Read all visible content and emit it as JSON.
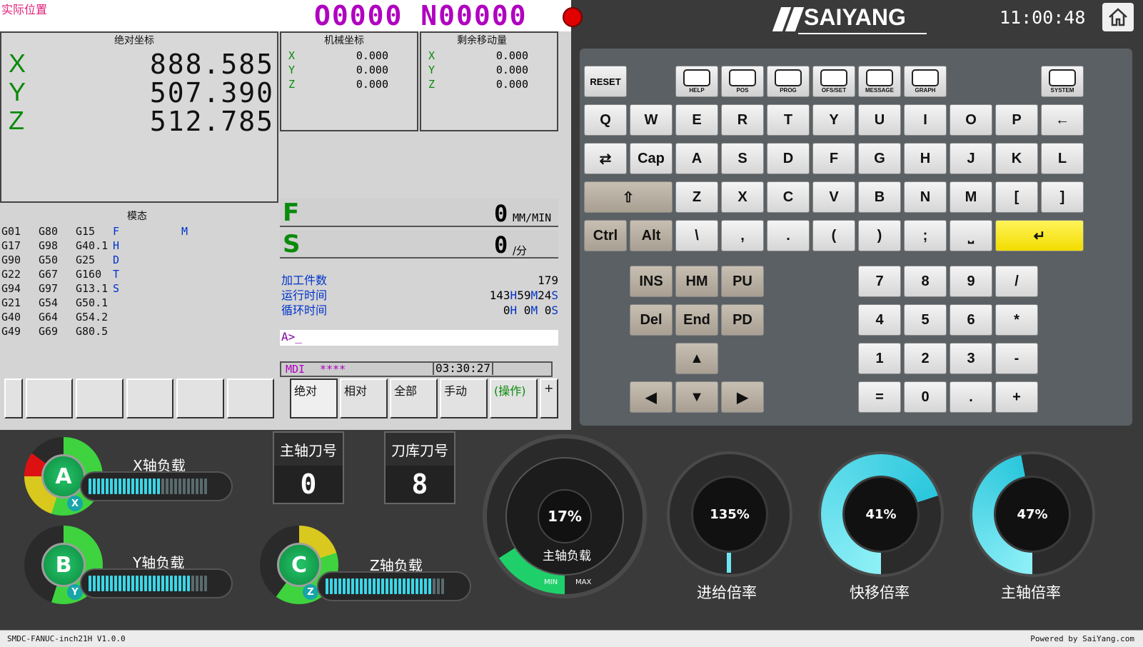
{
  "screen": {
    "title": "实际位置",
    "program": "O0000 N00000",
    "abs_title": "绝对坐标",
    "abs": [
      {
        "axis": "X",
        "value": "888.585"
      },
      {
        "axis": "Y",
        "value": "507.390"
      },
      {
        "axis": "Z",
        "value": "512.785"
      }
    ],
    "mach_title": "机械坐标",
    "mach": [
      {
        "axis": "X",
        "value": "0.000"
      },
      {
        "axis": "Y",
        "value": "0.000"
      },
      {
        "axis": "Z",
        "value": "0.000"
      }
    ],
    "remain_title": "剩余移动量",
    "remain": [
      {
        "axis": "X",
        "value": "0.000"
      },
      {
        "axis": "Y",
        "value": "0.000"
      },
      {
        "axis": "Z",
        "value": "0.000"
      }
    ],
    "modal_title": "模态",
    "modal_rows": [
      [
        "G01",
        "G80",
        "G15",
        "F",
        "M"
      ],
      [
        "G17",
        "G98",
        "G40.1",
        "H",
        ""
      ],
      [
        "G90",
        "G50",
        "G25",
        "D",
        ""
      ],
      [
        "G22",
        "G67",
        "G160",
        "T",
        ""
      ],
      [
        "G94",
        "G97",
        "G13.1",
        "S",
        ""
      ],
      [
        "G21",
        "G54",
        "G50.1",
        "",
        ""
      ],
      [
        "G40",
        "G64",
        "G54.2",
        "",
        ""
      ],
      [
        "G49",
        "G69",
        "G80.5",
        "",
        ""
      ]
    ],
    "feed_label": "F",
    "feed_value": "0",
    "feed_unit": "MM/MIN",
    "spindle_label": "S",
    "spindle_value": "0",
    "spindle_unit": "/分",
    "parts_label": "加工件数",
    "parts_value": "179",
    "run_label": "运行时间",
    "run_h": "143",
    "run_m": "59",
    "run_s": "24",
    "cycle_label": "循环时间",
    "cycle_h": "0",
    "cycle_m": "0",
    "cycle_s": "0",
    "h": "H",
    "m": "M",
    "s": "S",
    "prompt": "A>_",
    "mode": "MDI",
    "stars": "****",
    "clock": "03:30:27",
    "softkeys": [
      "绝对",
      "相对",
      "全部",
      "手动",
      "(操作)",
      "+"
    ]
  },
  "top": {
    "brand": "SAIYANG",
    "time": "11:00:48"
  },
  "func_keys": [
    "RESET",
    "HELP",
    "POS",
    "PROG",
    "OFS/SET",
    "MESSAGE",
    "GRAPH",
    "SYSTEM"
  ],
  "rows": {
    "r1": [
      "Q",
      "W",
      "E",
      "R",
      "T",
      "Y",
      "U",
      "I",
      "O",
      "P",
      "←"
    ],
    "r2": [
      "⇄",
      "Cap",
      "A",
      "S",
      "D",
      "F",
      "G",
      "H",
      "J",
      "K",
      "L"
    ],
    "r3": [
      "⇧",
      "Z",
      "X",
      "C",
      "V",
      "B",
      "N",
      "M",
      "[",
      "]"
    ],
    "r4": [
      "Ctrl",
      "Alt",
      "\\",
      ",",
      ".",
      "(",
      ")",
      ";",
      "⎵",
      "↵"
    ],
    "edit1": [
      "INS",
      "HM",
      "PU"
    ],
    "edit2": [
      "Del",
      "End",
      "PD"
    ],
    "arrows": [
      "▲",
      "◀",
      "▼",
      "▶"
    ],
    "num": [
      "7",
      "8",
      "9",
      "/",
      "4",
      "5",
      "6",
      "*",
      "1",
      "2",
      "3",
      "-",
      "=",
      "0",
      ".",
      "+"
    ]
  },
  "gauges": {
    "xload": "X轴负载",
    "yload": "Y轴负载",
    "zload": "Z轴负载",
    "a": "A",
    "b": "B",
    "c": "C",
    "xs": "X",
    "ys": "Y",
    "zs": "Z",
    "x_level": 0.6,
    "y_level": 0.85,
    "z_level": 0.88,
    "tool_spindle": "主轴刀号",
    "tool_spindle_val": "0",
    "tool_mag": "刀库刀号",
    "tool_mag_val": "8",
    "spindle_load": "17%",
    "spindle_load_label": "主轴负载",
    "min": "MIN",
    "max": "MAX",
    "feed": "135%",
    "feed_label": "进给倍率",
    "rapid": "41%",
    "rapid_label": "快移倍率",
    "spindle_ov": "47%",
    "spindle_ov_label": "主轴倍率"
  },
  "footer": {
    "left": "SMDC-FANUC-inch21H V1.0.0",
    "right": "Powered by SaiYang.com"
  }
}
